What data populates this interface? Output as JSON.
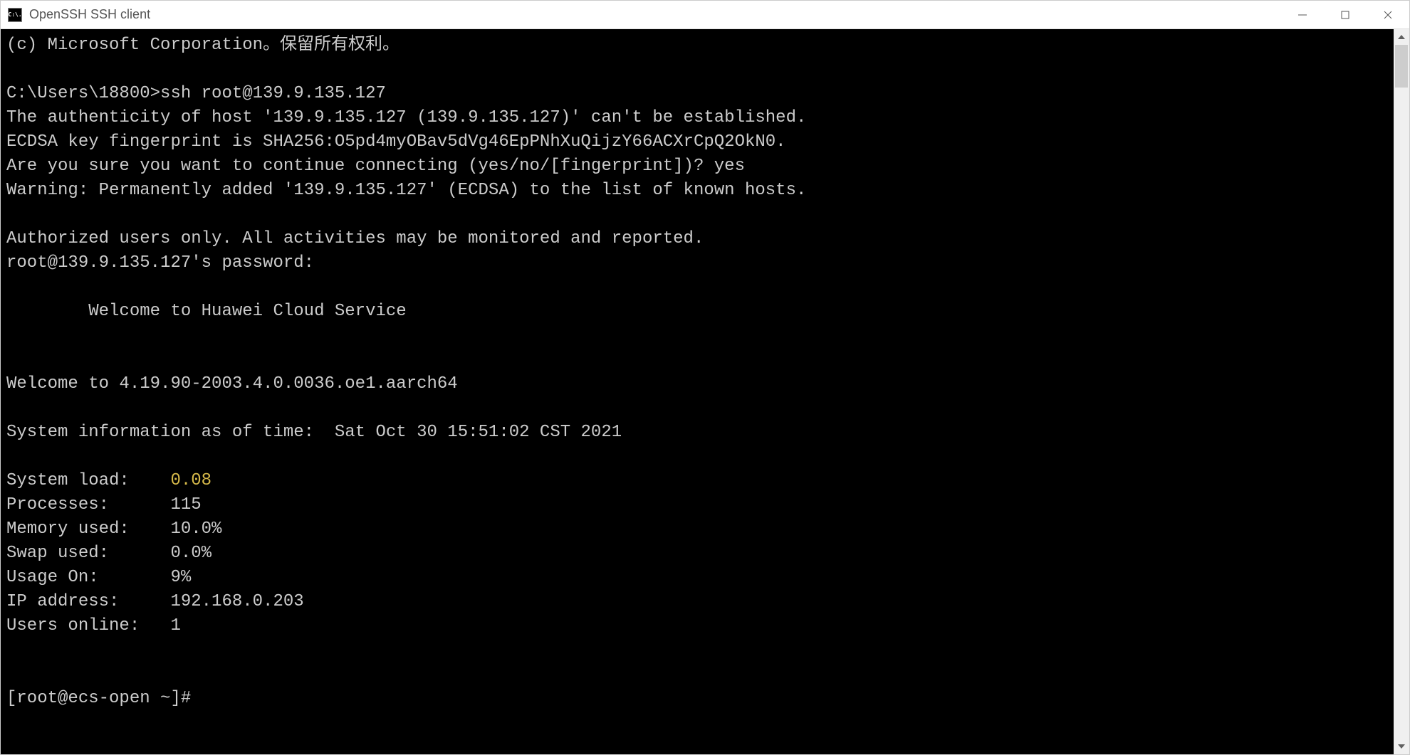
{
  "window": {
    "title": "OpenSSH SSH client",
    "icon_label": "C:\\."
  },
  "terminal": {
    "copyright": "(c) Microsoft Corporation。保留所有权利。",
    "blank1": "",
    "prompt_path": "C:\\Users\\18800>ssh root@139.9.135.127",
    "auth_line": "The authenticity of host '139.9.135.127 (139.9.135.127)' can't be established.",
    "fingerprint": "ECDSA key fingerprint is SHA256:O5pd4myOBav5dVg46EpPNhXuQijzY66ACXrCpQ2OkN0.",
    "confirm": "Are you sure you want to continue connecting (yes/no/[fingerprint])? yes",
    "warning": "Warning: Permanently added '139.9.135.127' (ECDSA) to the list of known hosts.",
    "blank2": "",
    "authorized": "Authorized users only. All activities may be monitored and reported.",
    "password_prompt": "root@139.9.135.127's password:",
    "blank3": "",
    "welcome1": "        Welcome to Huawei Cloud Service",
    "blank4": "",
    "blank5": "",
    "welcome2": "Welcome to 4.19.90-2003.4.0.0036.oe1.aarch64",
    "blank6": "",
    "sysinfo_time": "System information as of time:  Sat Oct 30 15:51:02 CST 2021",
    "blank7": "",
    "sysload_label": "System load:    ",
    "sysload_value": "0.08",
    "processes": "Processes:      115",
    "memory": "Memory used:    10.0%",
    "swap": "Swap used:      0.0%",
    "usage": "Usage On:       9%",
    "ip": "IP address:     192.168.0.203",
    "users": "Users online:   1",
    "blank8": "",
    "blank9": "",
    "root_prompt": "[root@ecs-open ~]#"
  }
}
